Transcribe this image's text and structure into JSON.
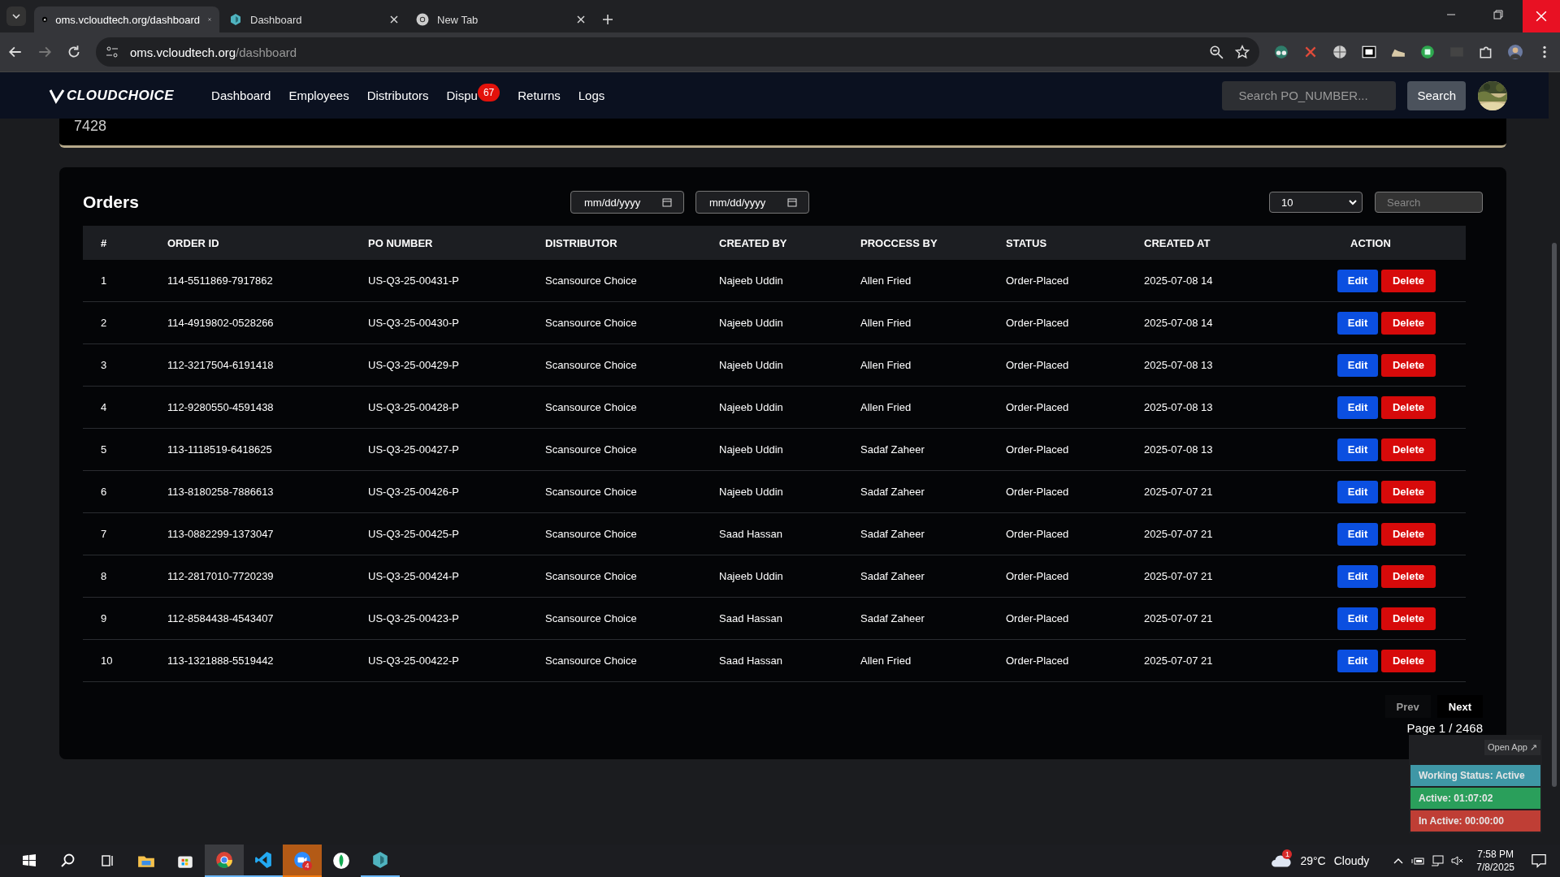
{
  "browser": {
    "tabs": [
      {
        "title": "oms.vcloudtech.org/dashboard",
        "selected": true,
        "kind": "triangle"
      },
      {
        "title": "Dashboard",
        "selected": false,
        "kind": "hex"
      },
      {
        "title": "New Tab",
        "selected": false,
        "kind": "chrome"
      }
    ],
    "address": {
      "host": "oms.vcloudtech.org",
      "path": "/dashboard"
    }
  },
  "navbar": {
    "logo": "CLOUDCHOICE",
    "items": [
      {
        "label": "Dashboard"
      },
      {
        "label": "Employees"
      },
      {
        "label": "Distributors"
      },
      {
        "label": "Dispu",
        "badge": "67"
      },
      {
        "label": "Returns"
      },
      {
        "label": "Logs"
      }
    ],
    "search": {
      "placeholder": "Search PO_NUMBER..."
    },
    "search_button": "Search"
  },
  "summary_card": {
    "value": "7428"
  },
  "orders": {
    "title": "Orders",
    "date_from": {
      "placeholder": "mm/dd/yyyy"
    },
    "date_to": {
      "placeholder": "mm/dd/yyyy"
    },
    "page_size": "10",
    "search": {
      "placeholder": "Search"
    },
    "columns": [
      "#",
      "ORDER ID",
      "PO NUMBER",
      "DISTRIBUTOR",
      "CREATED BY",
      "PROCCESS BY",
      "STATUS",
      "CREATED AT",
      "ACTION"
    ],
    "rows": [
      {
        "n": "1",
        "order_id": "114-5511869-7917862",
        "po": "US-Q3-25-00431-P",
        "distributor": "Scansource Choice",
        "created_by": "Najeeb Uddin",
        "processed_by": "Allen Fried",
        "status": "Order-Placed",
        "created_at": "2025-07-08 14",
        "edit": "Edit",
        "delete": "Delete"
      },
      {
        "n": "2",
        "order_id": "114-4919802-0528266",
        "po": "US-Q3-25-00430-P",
        "distributor": "Scansource Choice",
        "created_by": "Najeeb Uddin",
        "processed_by": "Allen Fried",
        "status": "Order-Placed",
        "created_at": "2025-07-08 14",
        "edit": "Edit",
        "delete": "Delete"
      },
      {
        "n": "3",
        "order_id": "112-3217504-6191418",
        "po": "US-Q3-25-00429-P",
        "distributor": "Scansource Choice",
        "created_by": "Najeeb Uddin",
        "processed_by": "Allen Fried",
        "status": "Order-Placed",
        "created_at": "2025-07-08 13",
        "edit": "Edit",
        "delete": "Delete"
      },
      {
        "n": "4",
        "order_id": "112-9280550-4591438",
        "po": "US-Q3-25-00428-P",
        "distributor": "Scansource Choice",
        "created_by": "Najeeb Uddin",
        "processed_by": "Allen Fried",
        "status": "Order-Placed",
        "created_at": "2025-07-08 13",
        "edit": "Edit",
        "delete": "Delete"
      },
      {
        "n": "5",
        "order_id": "113-1118519-6418625",
        "po": "US-Q3-25-00427-P",
        "distributor": "Scansource Choice",
        "created_by": "Najeeb Uddin",
        "processed_by": "Sadaf Zaheer",
        "status": "Order-Placed",
        "created_at": "2025-07-08 13",
        "edit": "Edit",
        "delete": "Delete"
      },
      {
        "n": "6",
        "order_id": "113-8180258-7886613",
        "po": "US-Q3-25-00426-P",
        "distributor": "Scansource Choice",
        "created_by": "Najeeb Uddin",
        "processed_by": "Sadaf Zaheer",
        "status": "Order-Placed",
        "created_at": "2025-07-07 21",
        "edit": "Edit",
        "delete": "Delete"
      },
      {
        "n": "7",
        "order_id": "113-0882299-1373047",
        "po": "US-Q3-25-00425-P",
        "distributor": "Scansource Choice",
        "created_by": "Saad Hassan",
        "processed_by": "Sadaf Zaheer",
        "status": "Order-Placed",
        "created_at": "2025-07-07 21",
        "edit": "Edit",
        "delete": "Delete"
      },
      {
        "n": "8",
        "order_id": "112-2817010-7720239",
        "po": "US-Q3-25-00424-P",
        "distributor": "Scansource Choice",
        "created_by": "Najeeb Uddin",
        "processed_by": "Sadaf Zaheer",
        "status": "Order-Placed",
        "created_at": "2025-07-07 21",
        "edit": "Edit",
        "delete": "Delete"
      },
      {
        "n": "9",
        "order_id": "112-8584438-4543407",
        "po": "US-Q3-25-00423-P",
        "distributor": "Scansource Choice",
        "created_by": "Saad Hassan",
        "processed_by": "Sadaf Zaheer",
        "status": "Order-Placed",
        "created_at": "2025-07-07 21",
        "edit": "Edit",
        "delete": "Delete"
      },
      {
        "n": "10",
        "order_id": "113-1321888-5519442",
        "po": "US-Q3-25-00422-P",
        "distributor": "Scansource Choice",
        "created_by": "Saad Hassan",
        "processed_by": "Allen Fried",
        "status": "Order-Placed",
        "created_at": "2025-07-07 21",
        "edit": "Edit",
        "delete": "Delete"
      }
    ],
    "prev": {
      "label": "Prev",
      "disabled": true
    },
    "next": {
      "label": "Next",
      "disabled": false
    },
    "page_info": "Page 1 / 2468"
  },
  "status_widget": {
    "open_app": "Open App ↗",
    "items": [
      {
        "text": "Working Status: Active",
        "color": "#3f97a6"
      },
      {
        "text": "Active: 01:07:02",
        "color": "#2a9f5b"
      },
      {
        "text": "In Active: 00:00:00",
        "color": "#bf3e35"
      }
    ]
  },
  "taskbar": {
    "apps": [
      {
        "kind": "explorer",
        "running": false,
        "focused": false,
        "flashing": false
      },
      {
        "kind": "store",
        "running": false,
        "focused": false,
        "flashing": false
      },
      {
        "kind": "chrome",
        "running": true,
        "focused": true,
        "flashing": false
      },
      {
        "kind": "vscode",
        "running": true,
        "focused": false,
        "flashing": false
      },
      {
        "kind": "zoom",
        "running": true,
        "focused": false,
        "flashing": true,
        "badge": "4"
      },
      {
        "kind": "leaf",
        "running": false,
        "focused": false,
        "flashing": false
      },
      {
        "kind": "hex",
        "running": true,
        "focused": false,
        "flashing": false
      }
    ],
    "weather": {
      "temp": "29°C",
      "condition": "Cloudy",
      "badge": "1"
    },
    "time": "7:58 PM",
    "date": "7/8/2025"
  }
}
